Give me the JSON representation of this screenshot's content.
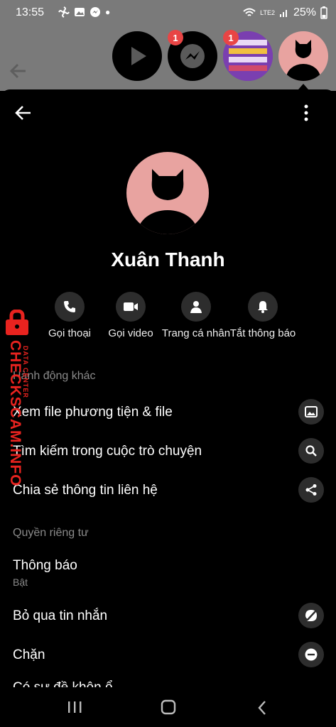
{
  "status_bar": {
    "time": "13:55",
    "network": "LTE2",
    "battery": "25%"
  },
  "chat_heads": [
    {
      "badge": "1"
    },
    {
      "badge": "1"
    }
  ],
  "profile": {
    "name": "Xuân Thanh"
  },
  "actions": [
    {
      "label": "Gọi thoại",
      "icon": "phone-icon"
    },
    {
      "label": "Gọi video",
      "icon": "video-icon"
    },
    {
      "label": "Trang cá nhân",
      "icon": "person-icon"
    },
    {
      "label": "Tắt thông báo",
      "icon": "bell-icon"
    }
  ],
  "sections": {
    "other_actions": "Hành động khác",
    "privacy": "Quyền riêng tư"
  },
  "menu": {
    "media": "Xem file phương tiện & file",
    "search": "Tìm kiếm trong cuộc trò chuyện",
    "share": "Chia sẻ thông tin liên hệ",
    "notifications": "Thông báo",
    "notifications_state": "Bật",
    "ignore": "Bỏ qua tin nhắn",
    "block": "Chặn",
    "partial": "Có sự đề khôn ổ"
  },
  "watermark": {
    "brand": "CHECKSCAM.INFO",
    "tag": "DATA CENTER"
  },
  "colors": {
    "background": "#000000",
    "button": "#2d2d2d",
    "avatar": "#e8a3a0",
    "badge": "#e84545",
    "watermark": "#e8231f"
  }
}
